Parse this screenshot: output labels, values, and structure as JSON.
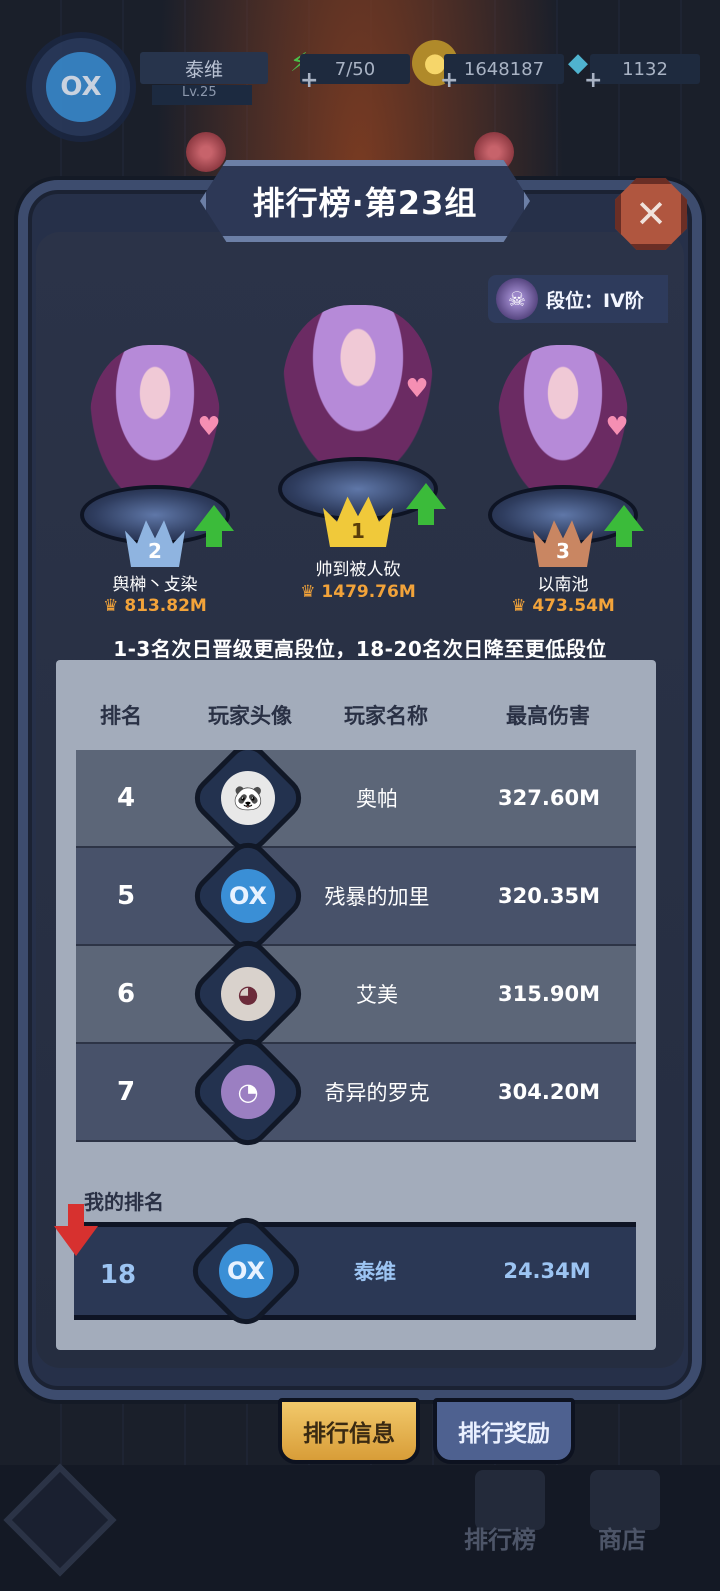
{
  "hud": {
    "player_name": "泰维",
    "level": "Lv.25",
    "energy": "7/50",
    "gold": "1648187",
    "gems": "1132",
    "avatar_mark": "OX"
  },
  "title": "排行榜·第23组",
  "close_symbol": "✕",
  "tier": {
    "label": "段位：IV阶"
  },
  "podium": [
    {
      "rank": "2",
      "name": "舆榊丶攴染",
      "score": "813.82M"
    },
    {
      "rank": "1",
      "name": "帅到被人砍",
      "score": "1479.76M"
    },
    {
      "rank": "3",
      "name": "以南池",
      "score": "473.54M"
    }
  ],
  "promotion_text": "1-3名次日晋级更高段位，18-20名次日降至更低段位",
  "table": {
    "headers": [
      "排名",
      "玩家头像",
      "玩家名称",
      "最高伤害"
    ],
    "rows": [
      {
        "rank": "4",
        "name": "奥帕",
        "damage": "327.60M",
        "face_color": "#e8e8e8",
        "face_glyph": "🐼"
      },
      {
        "rank": "5",
        "name": "残暴的加里",
        "damage": "320.35M",
        "face_color": "#3a8fd6",
        "face_glyph": "OX"
      },
      {
        "rank": "6",
        "name": "艾美",
        "damage": "315.90M",
        "face_color": "#d9d2cc",
        "face_glyph": "◕"
      },
      {
        "rank": "7",
        "name": "奇异的罗克",
        "damage": "304.20M",
        "face_color": "#9b7fc2",
        "face_glyph": "◔"
      }
    ]
  },
  "my_rank": {
    "label": "我的排名",
    "rank": "18",
    "name": "泰维",
    "damage": "24.34M"
  },
  "tabs": {
    "info": "排行信息",
    "reward": "排行奖励"
  },
  "bottom_nav": {
    "leaderboard": "排行榜",
    "shop": "商店"
  },
  "colors": {
    "accent_gold": "#f2a33a",
    "my_row_text": "#9cc4f2",
    "promote_green": "#3bbb3a",
    "demote_red": "#d7312f"
  }
}
